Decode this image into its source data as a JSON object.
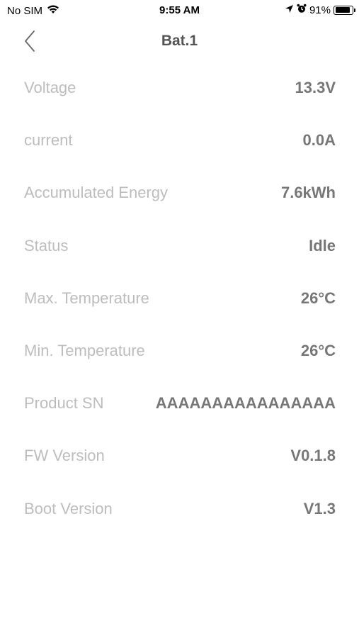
{
  "status_bar": {
    "carrier": "No SIM",
    "time": "9:55 AM",
    "battery_percent": "91%",
    "battery_level": 0.91,
    "icons": [
      "wifi-icon",
      "location-arrow-icon",
      "alarm-icon",
      "battery-icon"
    ]
  },
  "nav": {
    "title": "Bat.1",
    "back_icon": "chevron-left-icon"
  },
  "rows": [
    {
      "label": "Voltage",
      "value": "13.3V"
    },
    {
      "label": "current",
      "value": "0.0A"
    },
    {
      "label": "Accumulated Energy",
      "value": "7.6kWh"
    },
    {
      "label": "Status",
      "value": "Idle"
    },
    {
      "label": "Max. Temperature",
      "value": "26°C"
    },
    {
      "label": "Min. Temperature",
      "value": "26°C"
    },
    {
      "label": "Product SN",
      "value": "AAAAAAAAAAAAAAAA"
    },
    {
      "label": "FW Version",
      "value": "V0.1.8"
    },
    {
      "label": "Boot Version",
      "value": "V1.3"
    }
  ],
  "colors": {
    "label": "#bdbdbd",
    "value": "#777777",
    "title": "#555555",
    "background": "#ffffff"
  }
}
